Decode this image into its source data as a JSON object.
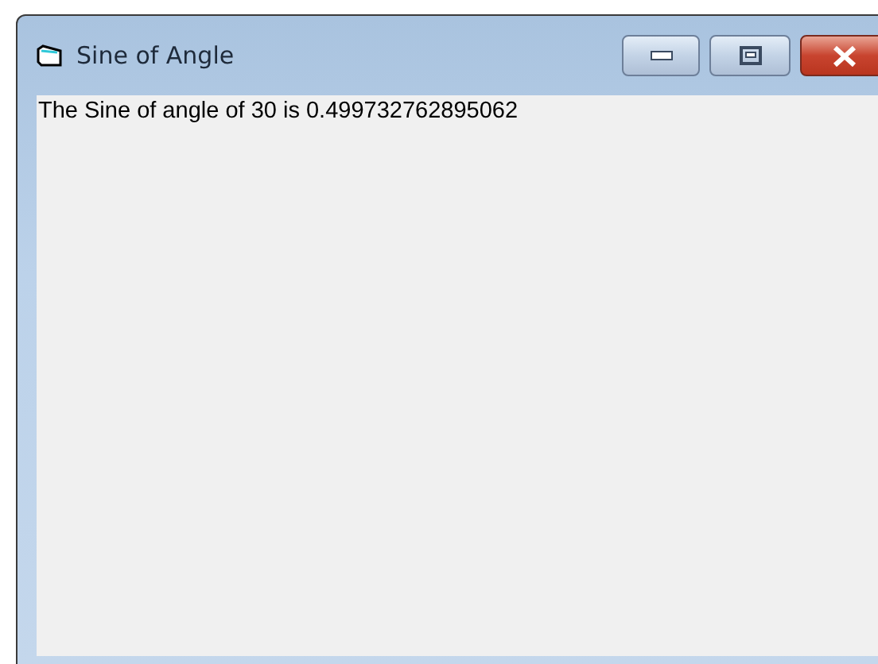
{
  "window": {
    "title": "Sine of Angle"
  },
  "content": {
    "text": "The Sine of angle of 30 is 0.499732762895062"
  }
}
